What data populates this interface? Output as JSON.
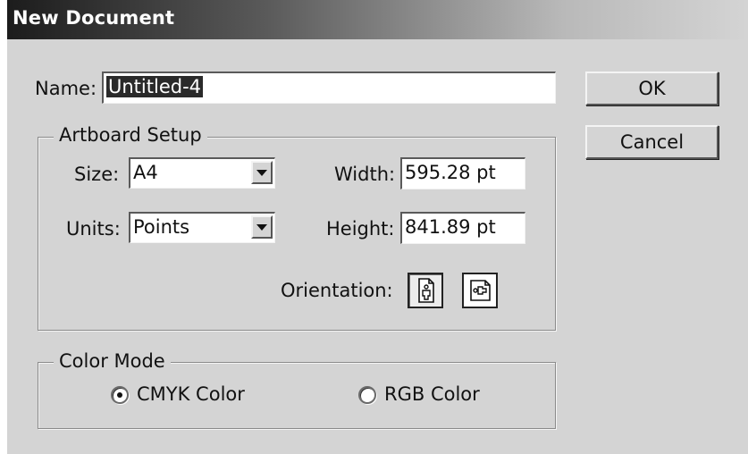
{
  "dialog": {
    "title": "New Document",
    "name_label": "Name:",
    "name_value": "Untitled-4",
    "ok_label": "OK",
    "cancel_label": "Cancel"
  },
  "artboard": {
    "group_label": "Artboard Setup",
    "size_label": "Size:",
    "size_value": "A4",
    "units_label": "Units:",
    "units_value": "Points",
    "width_label": "Width:",
    "width_value": "595.28 pt",
    "height_label": "Height:",
    "height_value": "841.89 pt",
    "orientation_label": "Orientation:",
    "orientation_selected": "portrait",
    "portrait_icon": "portrait-orientation-icon",
    "landscape_icon": "landscape-orientation-icon"
  },
  "color_mode": {
    "group_label": "Color Mode",
    "options": [
      {
        "label": "CMYK Color",
        "checked": true
      },
      {
        "label": "RGB Color",
        "checked": false
      }
    ]
  }
}
